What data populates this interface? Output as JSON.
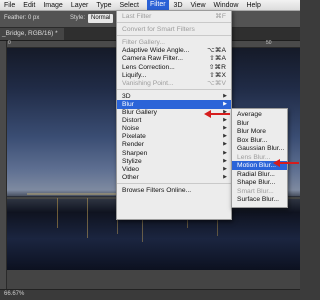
{
  "menubar": {
    "items": [
      "File",
      "Edit",
      "Image",
      "Layer",
      "Type",
      "Select",
      "Filter",
      "3D",
      "View",
      "Window",
      "Help"
    ],
    "active": "Filter"
  },
  "options_bar": {
    "feather_label": "Feather: 0 px",
    "style_label": "Style:",
    "style_value": "Normal"
  },
  "document_tab": {
    "title": "_Bridge, RGB/16) *"
  },
  "ruler": {
    "marks": [
      "0",
      "50"
    ]
  },
  "filter_menu": {
    "rows": [
      {
        "label": "Last Filter",
        "shortcut": "⌘F",
        "disabled": true
      },
      {
        "sep": true
      },
      {
        "label": "Convert for Smart Filters",
        "disabled": true
      },
      {
        "sep": true
      },
      {
        "label": "Filter Gallery...",
        "disabled": true
      },
      {
        "label": "Adaptive Wide Angle...",
        "shortcut": "⌥⌘A"
      },
      {
        "label": "Camera Raw Filter...",
        "shortcut": "⇧⌘A"
      },
      {
        "label": "Lens Correction...",
        "shortcut": "⇧⌘R"
      },
      {
        "label": "Liquify...",
        "shortcut": "⇧⌘X"
      },
      {
        "label": "Vanishing Point...",
        "shortcut": "⌥⌘V",
        "disabled": true
      },
      {
        "sep": true
      },
      {
        "label": "3D",
        "submenu": true
      },
      {
        "label": "Blur",
        "submenu": true,
        "highlighted": true
      },
      {
        "label": "Blur Gallery",
        "submenu": true
      },
      {
        "label": "Distort",
        "submenu": true
      },
      {
        "label": "Noise",
        "submenu": true
      },
      {
        "label": "Pixelate",
        "submenu": true
      },
      {
        "label": "Render",
        "submenu": true
      },
      {
        "label": "Sharpen",
        "submenu": true
      },
      {
        "label": "Stylize",
        "submenu": true
      },
      {
        "label": "Video",
        "submenu": true
      },
      {
        "label": "Other",
        "submenu": true
      },
      {
        "sep": true
      },
      {
        "label": "Browse Filters Online..."
      }
    ]
  },
  "blur_submenu": {
    "rows": [
      {
        "label": "Average"
      },
      {
        "label": "Blur"
      },
      {
        "label": "Blur More"
      },
      {
        "label": "Box Blur..."
      },
      {
        "label": "Gaussian Blur..."
      },
      {
        "label": "Lens Blur...",
        "disabled": true
      },
      {
        "label": "Motion Blur...",
        "highlighted": true
      },
      {
        "label": "Radial Blur..."
      },
      {
        "label": "Shape Blur..."
      },
      {
        "label": "Smart Blur...",
        "disabled": true
      },
      {
        "label": "Surface Blur..."
      }
    ]
  },
  "status_bar": {
    "text": "66.67%"
  },
  "colors": {
    "highlight": "#2b64d8",
    "annotation_arrow": "#d51d1d",
    "menu_bg": "#ececec"
  },
  "icons": {
    "submenu": "triangle-right-icon",
    "annotation": "red-arrow-icon"
  }
}
